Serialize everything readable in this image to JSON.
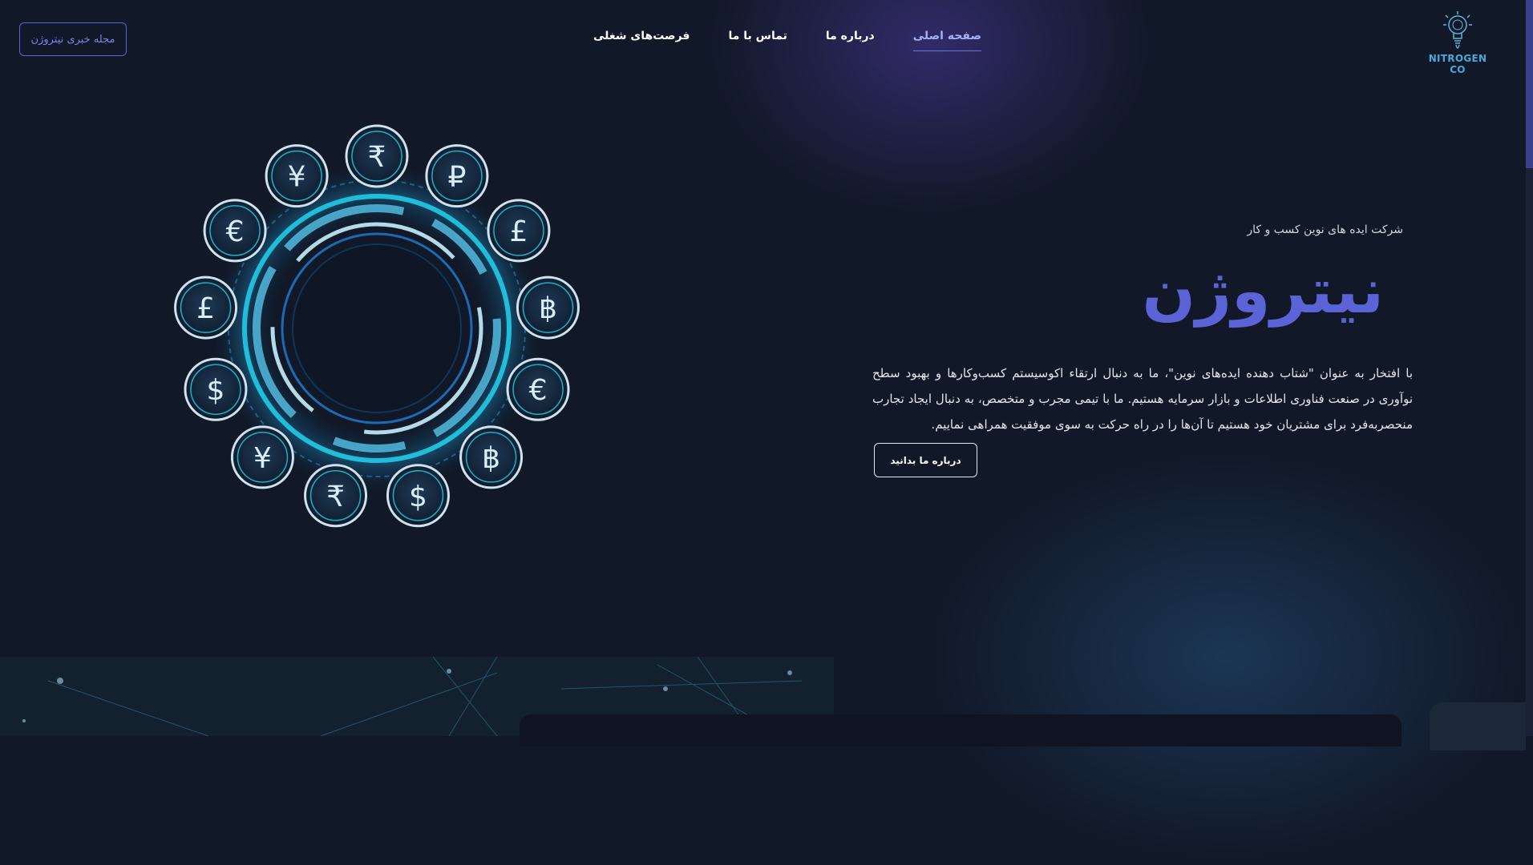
{
  "header": {
    "cta_label": "مجله خبری نیتروژن",
    "nav": [
      {
        "label": "صفحه اصلی",
        "active": true
      },
      {
        "label": "درباره ما",
        "active": false
      },
      {
        "label": "تماس با ما",
        "active": false
      },
      {
        "label": "فرصت‌های شغلی",
        "active": false
      }
    ],
    "logo_text": "NITROGEN CO",
    "logo_icon": "lightbulb-icon"
  },
  "hero": {
    "subtitle": "شرکت ایده های نوین کسب و کار",
    "title": "نیتروژن",
    "description": "با افتخار به عنوان \"شتاب دهنده ایده‌های نوین\"، ما به دنبال ارتقاء اکوسیستم کسب‌وکارها و بهبود سطح نوآوری در صنعت فناوری اطلاعات و بازار سرمایه هستیم. ما با تیمی مجرب و متخصص، به دنبال ایجاد تجارب منحصربه‌فرد برای مشتریان خود هستیم تا آن‌ها را در راه حرکت به سوی موفقیت همراهی نماییم.",
    "button_label": "درباره ما بدانید",
    "currency_symbols": [
      "₹",
      "₽",
      "£",
      "฿",
      "€",
      "฿",
      "$",
      "₹",
      "¥",
      "$",
      "£",
      "€",
      "¥"
    ]
  },
  "colors": {
    "background": "#111827",
    "accent": "#5b63d6",
    "ring_glow": "#22d3ee"
  }
}
